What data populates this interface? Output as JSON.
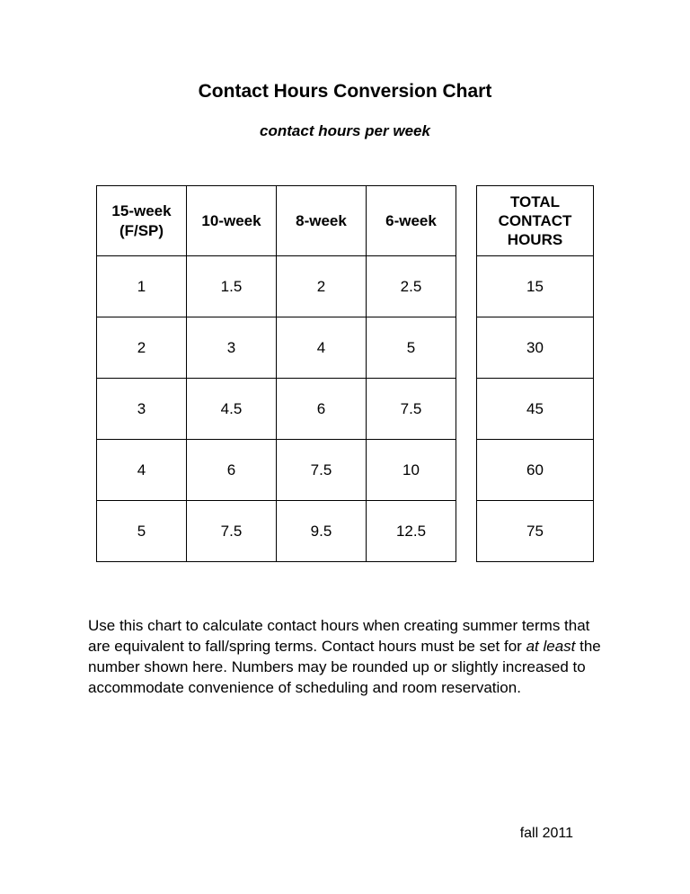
{
  "title": "Contact Hours Conversion Chart",
  "subtitle": "contact hours per week",
  "headers": {
    "c0a": "15-week",
    "c0b": "(F/SP)",
    "c1": "10-week",
    "c2": "8-week",
    "c3": "6-week",
    "totA": "TOTAL",
    "totB": "CONTACT",
    "totC": "HOURS"
  },
  "chart_data": {
    "type": "table",
    "columns": [
      "15-week (F/SP)",
      "10-week",
      "8-week",
      "6-week",
      "TOTAL CONTACT HOURS"
    ],
    "rows": [
      {
        "c0": "1",
        "c1": "1.5",
        "c2": "2",
        "c3": "2.5",
        "total": "15"
      },
      {
        "c0": "2",
        "c1": "3",
        "c2": "4",
        "c3": "5",
        "total": "30"
      },
      {
        "c0": "3",
        "c1": "4.5",
        "c2": "6",
        "c3": "7.5",
        "total": "45"
      },
      {
        "c0": "4",
        "c1": "6",
        "c2": "7.5",
        "c3": "10",
        "total": "60"
      },
      {
        "c0": "5",
        "c1": "7.5",
        "c2": "9.5",
        "c3": "12.5",
        "total": "75"
      }
    ]
  },
  "body": {
    "seg1": "Use this chart to calculate contact hours when creating summer terms that are equivalent to fall/spring terms. Contact hours must be set for ",
    "em1": "at least",
    "seg2": " the number shown here. Numbers may be rounded up or slightly increased to accommodate convenience of scheduling and room reservation."
  },
  "footer": "fall 2011"
}
